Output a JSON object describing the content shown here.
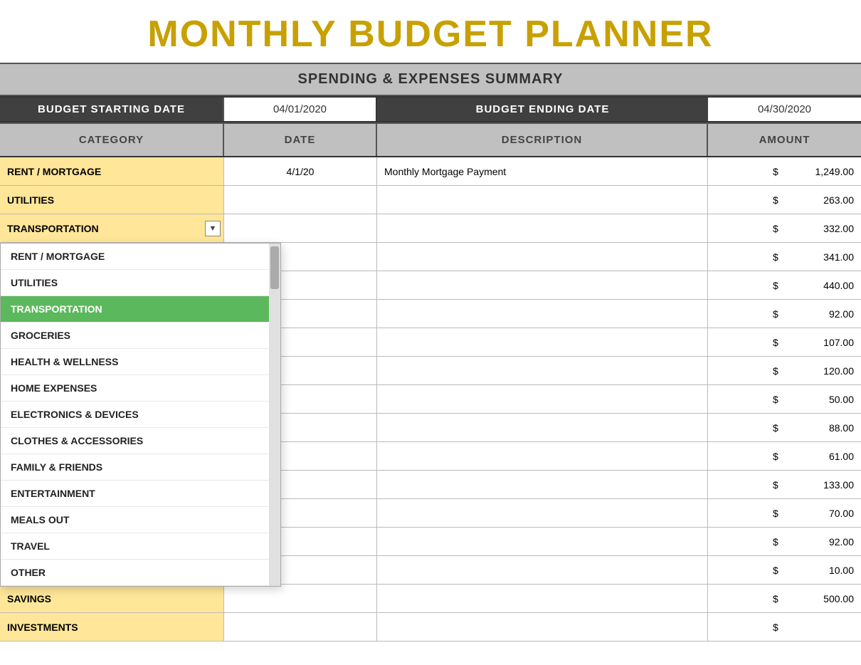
{
  "title": "MONTHLY BUDGET PLANNER",
  "subtitle": "SPENDING & EXPENSES SUMMARY",
  "budget_start_label": "BUDGET STARTING DATE",
  "budget_start_value": "04/01/2020",
  "budget_end_label": "BUDGET ENDING DATE",
  "budget_end_value": "04/30/2020",
  "columns": {
    "category": "CATEGORY",
    "date": "DATE",
    "description": "DESCRIPTION",
    "amount": "AMOUNT"
  },
  "rows": [
    {
      "category": "RENT / MORTGAGE",
      "cat_style": "yellow",
      "date": "4/1/20",
      "description": "Monthly Mortgage Payment",
      "dollar": "$",
      "amount": "1,249.00"
    },
    {
      "category": "UTILITIES",
      "cat_style": "yellow",
      "date": "",
      "description": "",
      "dollar": "$",
      "amount": "263.00"
    },
    {
      "category": "TRANSPORTATION",
      "cat_style": "yellow",
      "date": "",
      "description": "",
      "dollar": "$",
      "amount": "332.00",
      "has_dropdown": true
    },
    {
      "category": "",
      "cat_style": "white",
      "date": "",
      "description": "",
      "dollar": "$",
      "amount": "341.00"
    },
    {
      "category": "",
      "cat_style": "white",
      "date": "",
      "description": "",
      "dollar": "$",
      "amount": "440.00"
    },
    {
      "category": "",
      "cat_style": "white",
      "date": "",
      "description": "",
      "dollar": "$",
      "amount": "92.00"
    },
    {
      "category": "",
      "cat_style": "white",
      "date": "",
      "description": "",
      "dollar": "$",
      "amount": "107.00"
    },
    {
      "category": "",
      "cat_style": "white",
      "date": "",
      "description": "",
      "dollar": "$",
      "amount": "120.00"
    },
    {
      "category": "",
      "cat_style": "white",
      "date": "",
      "description": "",
      "dollar": "$",
      "amount": "50.00"
    },
    {
      "category": "",
      "cat_style": "white",
      "date": "",
      "description": "",
      "dollar": "$",
      "amount": "88.00"
    },
    {
      "category": "",
      "cat_style": "white",
      "date": "",
      "description": "",
      "dollar": "$",
      "amount": "61.00"
    },
    {
      "category": "",
      "cat_style": "white",
      "date": "",
      "description": "",
      "dollar": "$",
      "amount": "133.00"
    },
    {
      "category": "",
      "cat_style": "white",
      "date": "",
      "description": "",
      "dollar": "$",
      "amount": "70.00"
    },
    {
      "category": "",
      "cat_style": "white",
      "date": "",
      "description": "",
      "dollar": "$",
      "amount": "92.00"
    },
    {
      "category": "",
      "cat_style": "white",
      "date": "",
      "description": "",
      "dollar": "$",
      "amount": "10.00"
    },
    {
      "category": "SAVINGS",
      "cat_style": "yellow",
      "date": "",
      "description": "",
      "dollar": "$",
      "amount": "500.00"
    },
    {
      "category": "INVESTMENTS",
      "cat_style": "yellow",
      "date": "",
      "description": "",
      "dollar": "$",
      "amount": ""
    }
  ],
  "dropdown": {
    "items": [
      {
        "label": "RENT / MORTGAGE",
        "selected": false
      },
      {
        "label": "UTILITIES",
        "selected": false
      },
      {
        "label": "TRANSPORTATION",
        "selected": true
      },
      {
        "label": "GROCERIES",
        "selected": false
      },
      {
        "label": "HEALTH & WELLNESS",
        "selected": false
      },
      {
        "label": "HOME EXPENSES",
        "selected": false
      },
      {
        "label": "ELECTRONICS & DEVICES",
        "selected": false
      },
      {
        "label": "CLOTHES & ACCESSORIES",
        "selected": false
      },
      {
        "label": "FAMILY & FRIENDS",
        "selected": false
      },
      {
        "label": "ENTERTAINMENT",
        "selected": false
      },
      {
        "label": "MEALS OUT",
        "selected": false
      },
      {
        "label": "TRAVEL",
        "selected": false
      },
      {
        "label": "OTHER",
        "selected": false
      }
    ]
  },
  "dropdown_arrow": "▼"
}
